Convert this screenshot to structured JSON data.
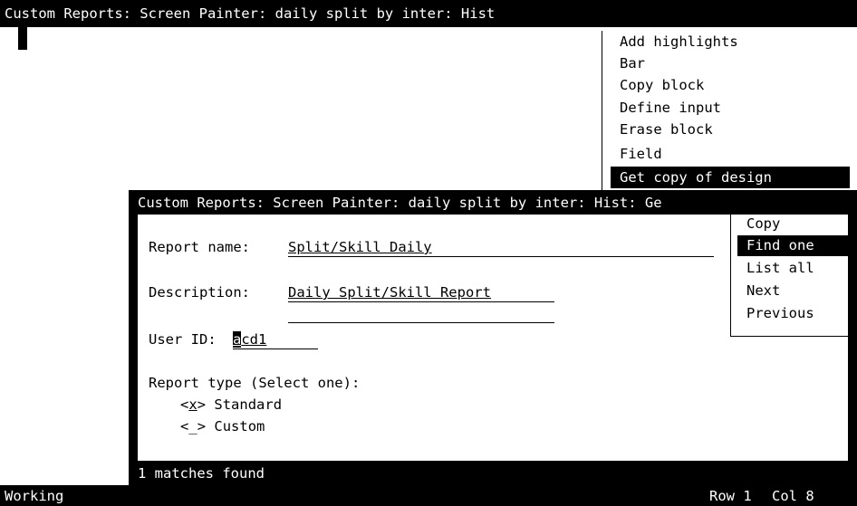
{
  "outer_title": "Custom Reports: Screen Painter: daily split by inter: Hist",
  "main_menu": [
    {
      "label": "Add highlights"
    },
    {
      "label": "Bar"
    },
    {
      "label": "Copy block"
    },
    {
      "label": "Define input"
    },
    {
      "label": "Erase block"
    },
    {
      "label": "Field"
    },
    {
      "label": "Get copy of design",
      "selected": true
    }
  ],
  "dialog": {
    "title": "Custom Reports: Screen Painter: daily split by inter: Hist: Ge",
    "report_name_label": "Report name:",
    "report_name_value": "Split/Skill Daily",
    "description_label": "Description:",
    "description_value": "Daily Split/Skill Report",
    "description_value2": "",
    "user_id_label": "User ID:",
    "user_id_cursor_char": "a",
    "user_id_rest": "cd1",
    "report_type_label": "Report type (Select one):",
    "options": [
      {
        "marker": "<x>",
        "mark_char": "x",
        "label": "Standard"
      },
      {
        "marker": "<_>",
        "mark_char": "_",
        "label": "Custom"
      }
    ],
    "status": "1 matches found"
  },
  "sub_menu": [
    {
      "label": "Copy"
    },
    {
      "label": "Find one",
      "selected": true
    },
    {
      "label": "List all"
    },
    {
      "label": "Next"
    },
    {
      "label": "Previous"
    }
  ],
  "bottom_bar": {
    "status": "Working",
    "row": "Row 1",
    "col": "Col 8"
  }
}
